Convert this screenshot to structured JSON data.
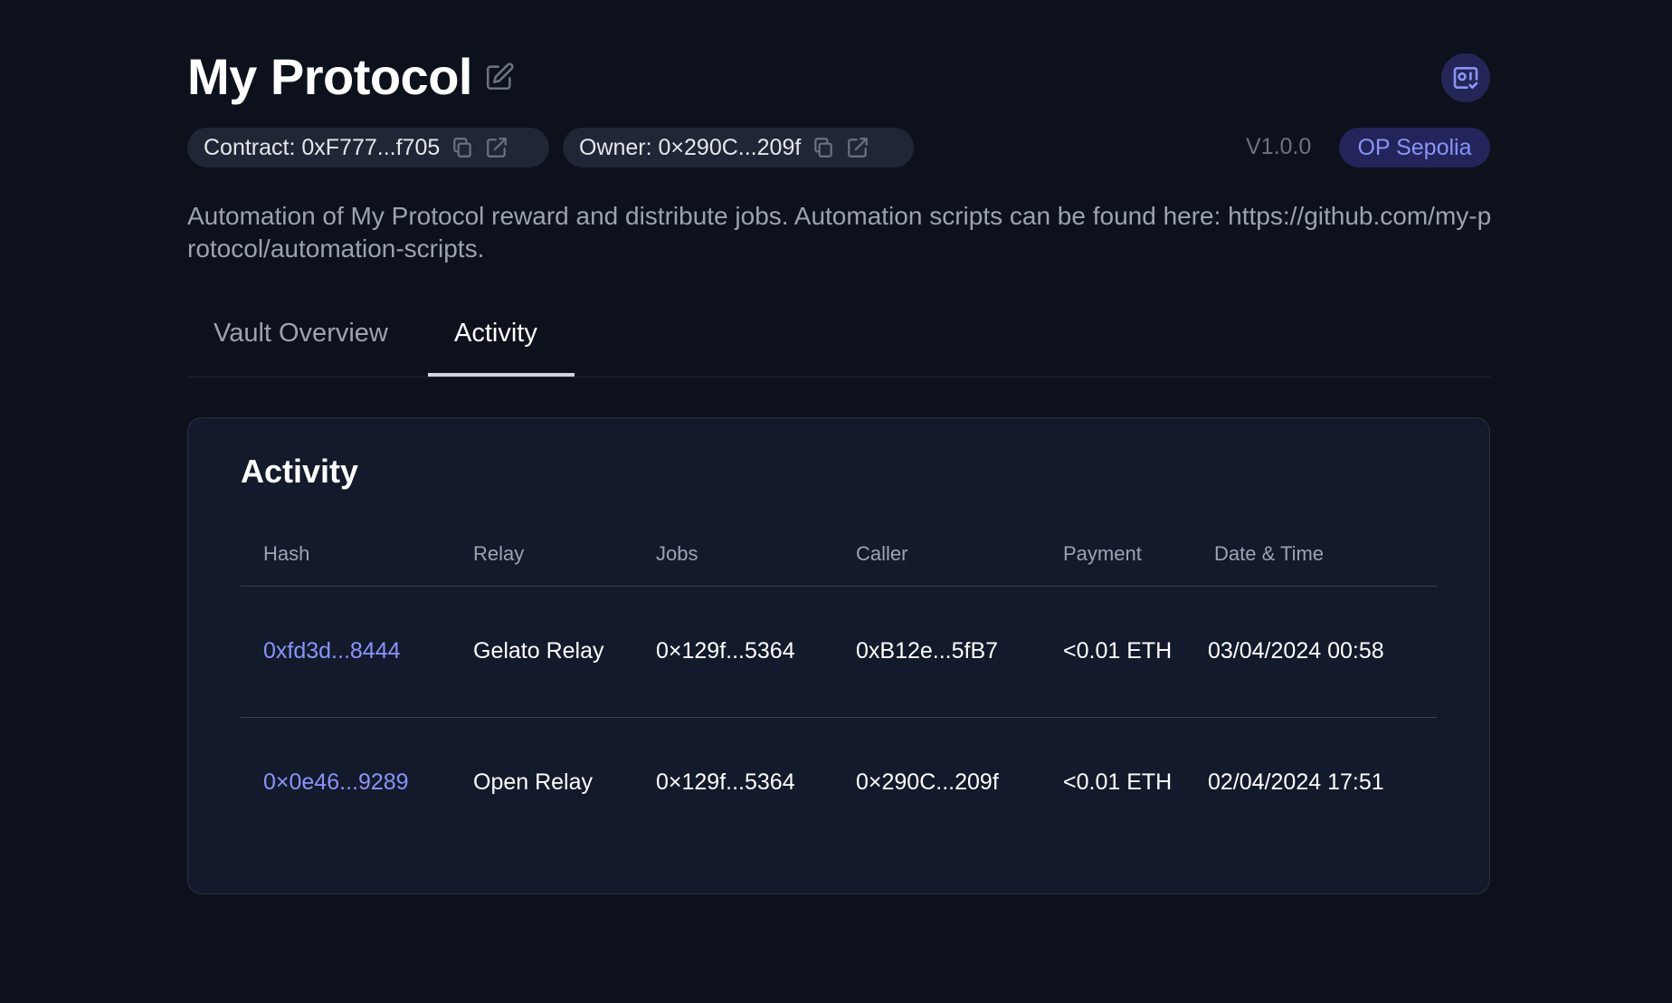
{
  "header": {
    "title": "My Protocol",
    "contract_label": "Contract: 0xF777...f705",
    "owner_label": "Owner: 0×290C...209f",
    "version": "V1.0.0",
    "network": "OP Sepolia",
    "description": "Automation of My Protocol reward and distribute jobs. Automation scripts can be found here: https://github.com/my-protocol/automation-scripts."
  },
  "icons": {
    "edit": "pencil-square-icon",
    "vault": "vault-check-icon",
    "copy": "copy-icon",
    "external_link": "external-link-icon"
  },
  "tabs": [
    {
      "label": "Vault Overview",
      "active": false
    },
    {
      "label": "Activity",
      "active": true
    }
  ],
  "activity": {
    "title": "Activity",
    "columns": [
      "Hash",
      "Relay",
      "Jobs",
      "Caller",
      "Payment",
      "Date & Time"
    ],
    "rows": [
      {
        "hash": "0xfd3d...8444",
        "relay": "Gelato Relay",
        "jobs": "0×129f...5364",
        "caller": "0xB12e...5fB7",
        "payment": "<0.01 ETH",
        "datetime": "03/04/2024 00:58"
      },
      {
        "hash": "0×0e46...9289",
        "relay": "Open Relay",
        "jobs": "0×129f...5364",
        "caller": "0×290C...209f",
        "payment": "<0.01 ETH",
        "datetime": "02/04/2024 17:51"
      }
    ]
  },
  "colors": {
    "background": "#0c111c",
    "card": "#131a2b",
    "accent": "#8b93f8",
    "network_badge_bg": "#22245a",
    "pill_bg": "#1f2636"
  }
}
